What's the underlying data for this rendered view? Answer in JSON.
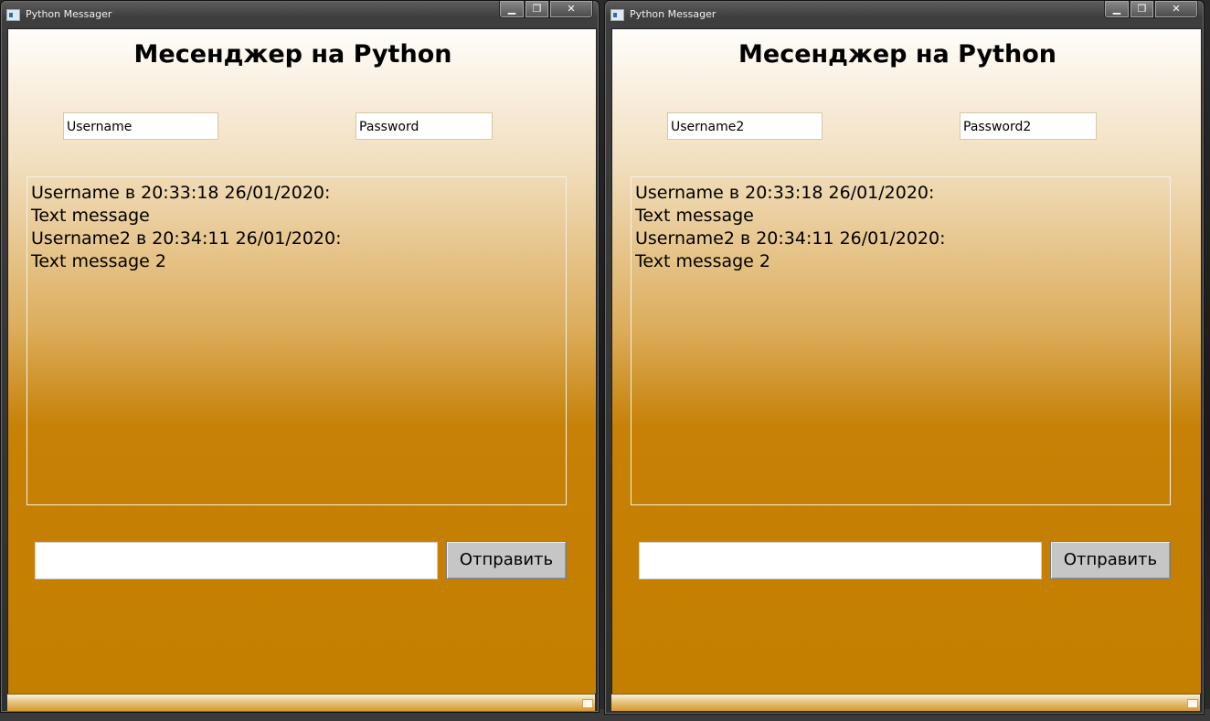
{
  "windows": [
    {
      "title": "Python Messager",
      "heading": "Месенджер на Python",
      "username": "Username",
      "password": "Password",
      "chat": [
        "Username в 20:33:18 26/01/2020:",
        "Text message",
        "Username2 в 20:34:11 26/01/2020:",
        "Text message 2"
      ],
      "message_input": "",
      "send_label": "Отправить",
      "caption": {
        "minimize": "▁",
        "maximize": "❐",
        "close": "✕"
      }
    },
    {
      "title": "Python Messager",
      "heading": "Месенджер на Python",
      "username": "Username2",
      "password": "Password2",
      "chat": [
        "Username в 20:33:18 26/01/2020:",
        "Text message",
        "Username2 в 20:34:11 26/01/2020:",
        "Text message 2"
      ],
      "message_input": "",
      "send_label": "Отправить",
      "caption": {
        "minimize": "▁",
        "maximize": "❐",
        "close": "✕"
      }
    }
  ],
  "colors": {
    "gradient_top": "#fffdfa",
    "gradient_bottom": "#c47f00",
    "button_gray": "#c6c6c6"
  }
}
